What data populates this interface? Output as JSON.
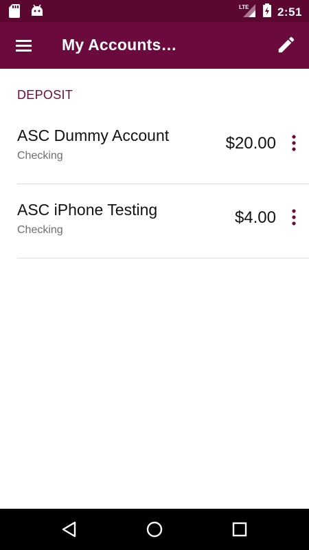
{
  "status_bar": {
    "time": "2:51",
    "network": "LTE",
    "icons": [
      "sd-card-icon",
      "android-icon",
      "lte-signal-icon",
      "battery-charging-icon"
    ]
  },
  "app_bar": {
    "title": "My Accounts…",
    "menu_icon": "hamburger-menu-icon",
    "edit_icon": "pencil-icon"
  },
  "section": {
    "header": "DEPOSIT"
  },
  "accounts": [
    {
      "name": "ASC Dummy Account",
      "type": "Checking",
      "balance": "$20.00"
    },
    {
      "name": "ASC iPhone Testing",
      "type": "Checking",
      "balance": "$4.00"
    }
  ],
  "nav_bar": {
    "icons": [
      "back-icon",
      "home-icon",
      "recents-icon"
    ]
  },
  "colors": {
    "status_bar": "#5c0632",
    "app_bar": "#6b0a3c",
    "accent": "#6b0a3c",
    "divider": "#dcdcdc"
  }
}
